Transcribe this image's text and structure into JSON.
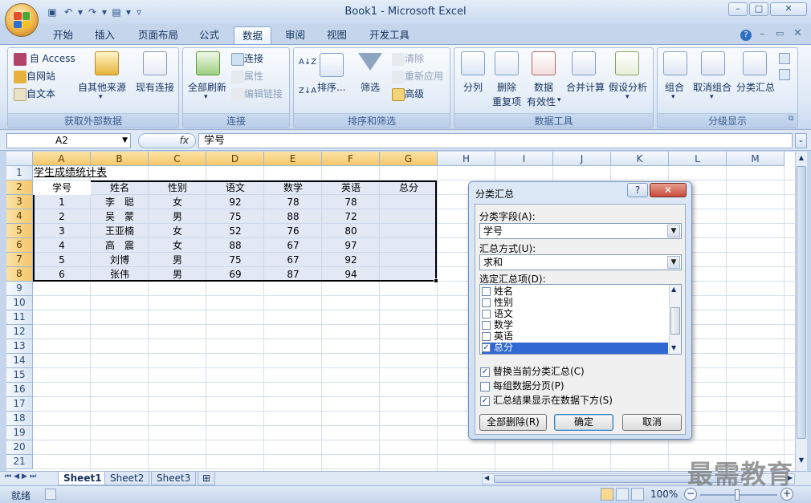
{
  "window": {
    "title": "Book1 - Microsoft Excel",
    "min": "–",
    "max": "□",
    "close": "✕"
  },
  "colors": {
    "selection_header": "#f5c76a",
    "ribbon": "#dde8f5",
    "dialog_close": "#c84a3a"
  },
  "ribbon_tabs": [
    "开始",
    "插入",
    "页面布局",
    "公式",
    "数据",
    "审阅",
    "视图",
    "开发工具"
  ],
  "active_tab": "数据",
  "ribbon": {
    "external": {
      "label": "获取外部数据",
      "access": "自 Access",
      "web": "自网站",
      "text": "自文本",
      "other": "自其他来源",
      "existing": "现有连接"
    },
    "connections": {
      "label": "连接",
      "refresh": "全部刷新",
      "conn": "连接",
      "props": "属性",
      "edit": "编辑链接"
    },
    "sort": {
      "label": "排序和筛选",
      "az": "A↓Z",
      "za": "Z↓A",
      "sort": "排序...",
      "filter": "筛选",
      "clear": "清除",
      "reapply": "重新应用",
      "advanced": "高级"
    },
    "tools": {
      "label": "数据工具",
      "split": "分列",
      "remove_dup_1": "删除",
      "remove_dup_2": "重复项",
      "validation_1": "数据",
      "validation_2": "有效性",
      "consolidate": "合并计算",
      "whatif": "假设分析"
    },
    "outline": {
      "label": "分级显示",
      "group": "组合",
      "ungroup": "取消组合",
      "subtotal": "分类汇总"
    }
  },
  "formula_bar": {
    "name_box": "A2",
    "fx": "fx",
    "content": "学号"
  },
  "columns": [
    "A",
    "B",
    "C",
    "D",
    "E",
    "F",
    "G",
    "H",
    "I",
    "J",
    "K",
    "L",
    "M"
  ],
  "rows": [
    "1",
    "2",
    "3",
    "4",
    "5",
    "6",
    "7",
    "8",
    "9",
    "10",
    "11",
    "12",
    "13",
    "14",
    "15",
    "16",
    "17",
    "18",
    "19",
    "20",
    "21"
  ],
  "sheet": {
    "title": "学生成绩统计表",
    "headers": [
      "学号",
      "姓名",
      "性别",
      "语文",
      "数学",
      "英语",
      "总分"
    ],
    "data": [
      [
        "1",
        "李　聪",
        "女",
        "92",
        "78",
        "78",
        ""
      ],
      [
        "2",
        "吴　蒙",
        "男",
        "75",
        "88",
        "72",
        ""
      ],
      [
        "3",
        "王亚楠",
        "女",
        "52",
        "76",
        "80",
        ""
      ],
      [
        "4",
        "高　震",
        "女",
        "88",
        "67",
        "97",
        ""
      ],
      [
        "5",
        "刘博",
        "男",
        "75",
        "67",
        "92",
        ""
      ],
      [
        "6",
        "张伟",
        "男",
        "69",
        "87",
        "94",
        ""
      ]
    ]
  },
  "dialog": {
    "title": "分类汇总",
    "help": "?",
    "close": "✕",
    "field_label": "分类字段(A):",
    "field_value": "学号",
    "method_label": "汇总方式(U):",
    "method_value": "求和",
    "items_label": "选定汇总项(D):",
    "items": [
      {
        "name": "姓名",
        "checked": false
      },
      {
        "name": "性别",
        "checked": false
      },
      {
        "name": "语文",
        "checked": false
      },
      {
        "name": "数学",
        "checked": false
      },
      {
        "name": "英语",
        "checked": false
      },
      {
        "name": "总分",
        "checked": true
      }
    ],
    "opt_replace": "替换当前分类汇总(C)",
    "opt_pagebreak": "每组数据分页(P)",
    "opt_below": "汇总结果显示在数据下方(S)",
    "btn_remove_all": "全部删除(R)",
    "btn_ok": "确定",
    "btn_cancel": "取消"
  },
  "sheet_tabs": [
    "Sheet1",
    "Sheet2",
    "Sheet3"
  ],
  "status": {
    "ready": "就绪",
    "zoom": "100%"
  },
  "watermark": "最需教育"
}
